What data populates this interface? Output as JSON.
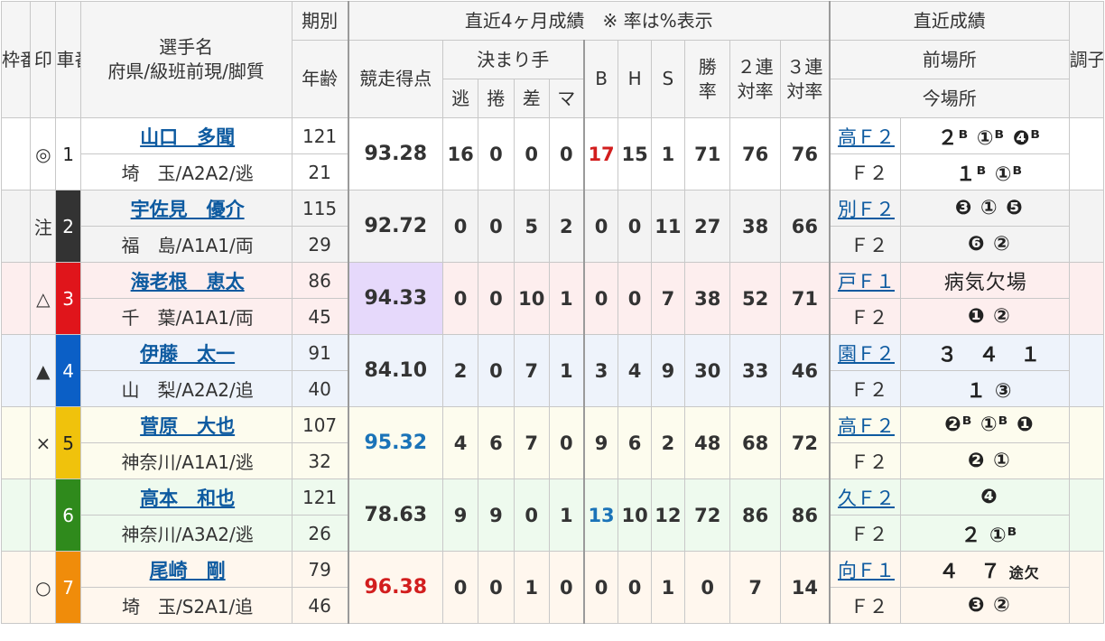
{
  "header": {
    "frame": "枠番",
    "mark": "印",
    "car": "車番",
    "name_line1": "選手名",
    "name_line2": "府県/級班前現/脚質",
    "term": "期別",
    "age": "年齢",
    "recent4": "直近4ヶ月成績　※ 率は%表示",
    "score": "競走得点",
    "kimarite": "決まり手",
    "nige": "逃",
    "makuri": "捲",
    "sashi": "差",
    "ma": "マ",
    "b": "B",
    "h": "H",
    "s": "S",
    "win_l1": "勝",
    "win_l2": "率",
    "two_l1": "２連",
    "two_l2": "対率",
    "three_l1": "３連",
    "three_l2": "対率",
    "recent": "直近成績",
    "prev_venue": "前場所",
    "cur_venue": "今場所",
    "cond": "調子"
  },
  "riders": [
    {
      "car": "1",
      "mark": "◎",
      "name": "山口　多聞",
      "info": "埼　玉/A2A2/逃",
      "term": "121",
      "age": "21",
      "score": "93.28",
      "nige": "16",
      "makuri": "0",
      "sashi": "0",
      "ma": "0",
      "b": "17",
      "h": "15",
      "s": "1",
      "win": "71",
      "two": "76",
      "three": "76",
      "prev_venue": "高Ｆ２",
      "prev_res": "２ᴮ ①ᴮ ❹ᴮ",
      "cur_venue": "Ｆ２",
      "cur_res": "１ᴮ ①ᴮ"
    },
    {
      "car": "2",
      "mark": "注",
      "name": "宇佐見　優介",
      "info": "福　島/A1A1/両",
      "term": "115",
      "age": "29",
      "score": "92.72",
      "nige": "0",
      "makuri": "0",
      "sashi": "5",
      "ma": "2",
      "b": "0",
      "h": "0",
      "s": "11",
      "win": "27",
      "two": "38",
      "three": "66",
      "prev_venue": "別Ｆ２",
      "prev_res": "❸ ① ❺",
      "cur_venue": "Ｆ２",
      "cur_res": "❻ ②"
    },
    {
      "car": "3",
      "mark": "△",
      "name": "海老根　恵太",
      "info": "千　葉/A1A1/両",
      "term": "86",
      "age": "45",
      "score": "94.33",
      "nige": "0",
      "makuri": "0",
      "sashi": "10",
      "ma": "1",
      "b": "0",
      "h": "0",
      "s": "7",
      "win": "38",
      "two": "52",
      "three": "71",
      "prev_venue": "戸Ｆ１",
      "prev_res": "病気欠場",
      "cur_venue": "Ｆ２",
      "cur_res": "❶ ②"
    },
    {
      "car": "4",
      "mark": "▲",
      "name": "伊藤　太一",
      "info": "山　梨/A2A2/追",
      "term": "91",
      "age": "40",
      "score": "84.10",
      "nige": "2",
      "makuri": "0",
      "sashi": "7",
      "ma": "1",
      "b": "3",
      "h": "4",
      "s": "9",
      "win": "30",
      "two": "33",
      "three": "46",
      "prev_venue": "園Ｆ２",
      "prev_res": "３　４　１",
      "cur_venue": "Ｆ２",
      "cur_res": "１ ③"
    },
    {
      "car": "5",
      "mark": "×",
      "name": "菅原　大也",
      "info": "神奈川/A1A1/逃",
      "term": "107",
      "age": "32",
      "score": "95.32",
      "nige": "4",
      "makuri": "6",
      "sashi": "7",
      "ma": "0",
      "b": "9",
      "h": "6",
      "s": "2",
      "win": "48",
      "two": "68",
      "three": "72",
      "prev_venue": "高Ｆ２",
      "prev_res": "❷ᴮ ①ᴮ ❶",
      "cur_venue": "Ｆ２",
      "cur_res": "❷ ①"
    },
    {
      "car": "6",
      "mark": "",
      "name": "高本　和也",
      "info": "神奈川/A3A2/逃",
      "term": "121",
      "age": "26",
      "score": "78.63",
      "nige": "9",
      "makuri": "9",
      "sashi": "0",
      "ma": "1",
      "b": "13",
      "h": "10",
      "s": "12",
      "win": "72",
      "two": "86",
      "three": "86",
      "prev_venue": "久Ｆ２",
      "prev_res": "❹",
      "cur_venue": "Ｆ２",
      "cur_res": "２ ①ᴮ"
    },
    {
      "car": "7",
      "mark": "○",
      "name": "尾崎　剛",
      "info": "埼　玉/S2A1/追",
      "term": "79",
      "age": "46",
      "score": "96.38",
      "nige": "0",
      "makuri": "0",
      "sashi": "1",
      "ma": "0",
      "b": "0",
      "h": "0",
      "s": "1",
      "win": "0",
      "two": "7",
      "three": "14",
      "prev_venue": "向Ｆ１",
      "prev_res": "４　７",
      "prev_res_extra": "途欠",
      "cur_venue": "Ｆ２",
      "cur_res": "❸ ②"
    }
  ],
  "colors": {
    "frame1": "#ffffff",
    "frame2": "#333333",
    "frame3": "#e0151b",
    "frame4": "#0b5fc6",
    "frame5": "#f0c20c",
    "frame6": "#2f8a1c",
    "frame7": "#f08c0a",
    "highlight_red": "#d21e1e",
    "highlight_blue": "#1a73b8",
    "link": "#0d5aa0"
  }
}
